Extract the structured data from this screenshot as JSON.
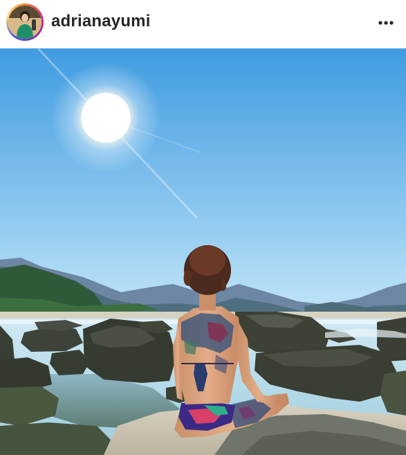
{
  "post": {
    "username": "adrianayumi",
    "more_icon": "more-horizontal-icon",
    "avatar_icon": "profile-avatar",
    "photo": {
      "subject": "beach-meditation-photo",
      "colors": {
        "sky_top": "#3f9ce0",
        "sky_bottom": "#c4e6f8",
        "sea": "#a9d6e8",
        "rock": "#3e443b",
        "sand": "#cfc7b5"
      }
    }
  }
}
